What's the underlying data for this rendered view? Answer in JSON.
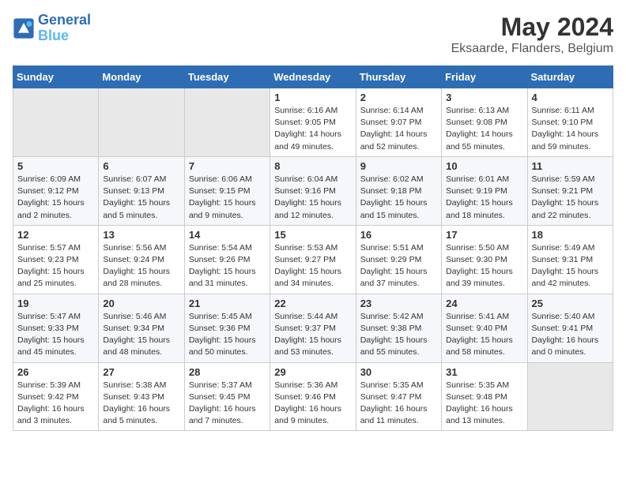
{
  "header": {
    "logo_line1": "General",
    "logo_line2": "Blue",
    "title": "May 2024",
    "subtitle": "Eksaarde, Flanders, Belgium"
  },
  "weekdays": [
    "Sunday",
    "Monday",
    "Tuesday",
    "Wednesday",
    "Thursday",
    "Friday",
    "Saturday"
  ],
  "weeks": [
    [
      {
        "day": "",
        "info": ""
      },
      {
        "day": "",
        "info": ""
      },
      {
        "day": "",
        "info": ""
      },
      {
        "day": "1",
        "info": "Sunrise: 6:16 AM\nSunset: 9:05 PM\nDaylight: 14 hours\nand 49 minutes."
      },
      {
        "day": "2",
        "info": "Sunrise: 6:14 AM\nSunset: 9:07 PM\nDaylight: 14 hours\nand 52 minutes."
      },
      {
        "day": "3",
        "info": "Sunrise: 6:13 AM\nSunset: 9:08 PM\nDaylight: 14 hours\nand 55 minutes."
      },
      {
        "day": "4",
        "info": "Sunrise: 6:11 AM\nSunset: 9:10 PM\nDaylight: 14 hours\nand 59 minutes."
      }
    ],
    [
      {
        "day": "5",
        "info": "Sunrise: 6:09 AM\nSunset: 9:12 PM\nDaylight: 15 hours\nand 2 minutes."
      },
      {
        "day": "6",
        "info": "Sunrise: 6:07 AM\nSunset: 9:13 PM\nDaylight: 15 hours\nand 5 minutes."
      },
      {
        "day": "7",
        "info": "Sunrise: 6:06 AM\nSunset: 9:15 PM\nDaylight: 15 hours\nand 9 minutes."
      },
      {
        "day": "8",
        "info": "Sunrise: 6:04 AM\nSunset: 9:16 PM\nDaylight: 15 hours\nand 12 minutes."
      },
      {
        "day": "9",
        "info": "Sunrise: 6:02 AM\nSunset: 9:18 PM\nDaylight: 15 hours\nand 15 minutes."
      },
      {
        "day": "10",
        "info": "Sunrise: 6:01 AM\nSunset: 9:19 PM\nDaylight: 15 hours\nand 18 minutes."
      },
      {
        "day": "11",
        "info": "Sunrise: 5:59 AM\nSunset: 9:21 PM\nDaylight: 15 hours\nand 22 minutes."
      }
    ],
    [
      {
        "day": "12",
        "info": "Sunrise: 5:57 AM\nSunset: 9:23 PM\nDaylight: 15 hours\nand 25 minutes."
      },
      {
        "day": "13",
        "info": "Sunrise: 5:56 AM\nSunset: 9:24 PM\nDaylight: 15 hours\nand 28 minutes."
      },
      {
        "day": "14",
        "info": "Sunrise: 5:54 AM\nSunset: 9:26 PM\nDaylight: 15 hours\nand 31 minutes."
      },
      {
        "day": "15",
        "info": "Sunrise: 5:53 AM\nSunset: 9:27 PM\nDaylight: 15 hours\nand 34 minutes."
      },
      {
        "day": "16",
        "info": "Sunrise: 5:51 AM\nSunset: 9:29 PM\nDaylight: 15 hours\nand 37 minutes."
      },
      {
        "day": "17",
        "info": "Sunrise: 5:50 AM\nSunset: 9:30 PM\nDaylight: 15 hours\nand 39 minutes."
      },
      {
        "day": "18",
        "info": "Sunrise: 5:49 AM\nSunset: 9:31 PM\nDaylight: 15 hours\nand 42 minutes."
      }
    ],
    [
      {
        "day": "19",
        "info": "Sunrise: 5:47 AM\nSunset: 9:33 PM\nDaylight: 15 hours\nand 45 minutes."
      },
      {
        "day": "20",
        "info": "Sunrise: 5:46 AM\nSunset: 9:34 PM\nDaylight: 15 hours\nand 48 minutes."
      },
      {
        "day": "21",
        "info": "Sunrise: 5:45 AM\nSunset: 9:36 PM\nDaylight: 15 hours\nand 50 minutes."
      },
      {
        "day": "22",
        "info": "Sunrise: 5:44 AM\nSunset: 9:37 PM\nDaylight: 15 hours\nand 53 minutes."
      },
      {
        "day": "23",
        "info": "Sunrise: 5:42 AM\nSunset: 9:38 PM\nDaylight: 15 hours\nand 55 minutes."
      },
      {
        "day": "24",
        "info": "Sunrise: 5:41 AM\nSunset: 9:40 PM\nDaylight: 15 hours\nand 58 minutes."
      },
      {
        "day": "25",
        "info": "Sunrise: 5:40 AM\nSunset: 9:41 PM\nDaylight: 16 hours\nand 0 minutes."
      }
    ],
    [
      {
        "day": "26",
        "info": "Sunrise: 5:39 AM\nSunset: 9:42 PM\nDaylight: 16 hours\nand 3 minutes."
      },
      {
        "day": "27",
        "info": "Sunrise: 5:38 AM\nSunset: 9:43 PM\nDaylight: 16 hours\nand 5 minutes."
      },
      {
        "day": "28",
        "info": "Sunrise: 5:37 AM\nSunset: 9:45 PM\nDaylight: 16 hours\nand 7 minutes."
      },
      {
        "day": "29",
        "info": "Sunrise: 5:36 AM\nSunset: 9:46 PM\nDaylight: 16 hours\nand 9 minutes."
      },
      {
        "day": "30",
        "info": "Sunrise: 5:35 AM\nSunset: 9:47 PM\nDaylight: 16 hours\nand 11 minutes."
      },
      {
        "day": "31",
        "info": "Sunrise: 5:35 AM\nSunset: 9:48 PM\nDaylight: 16 hours\nand 13 minutes."
      },
      {
        "day": "",
        "info": ""
      }
    ]
  ]
}
